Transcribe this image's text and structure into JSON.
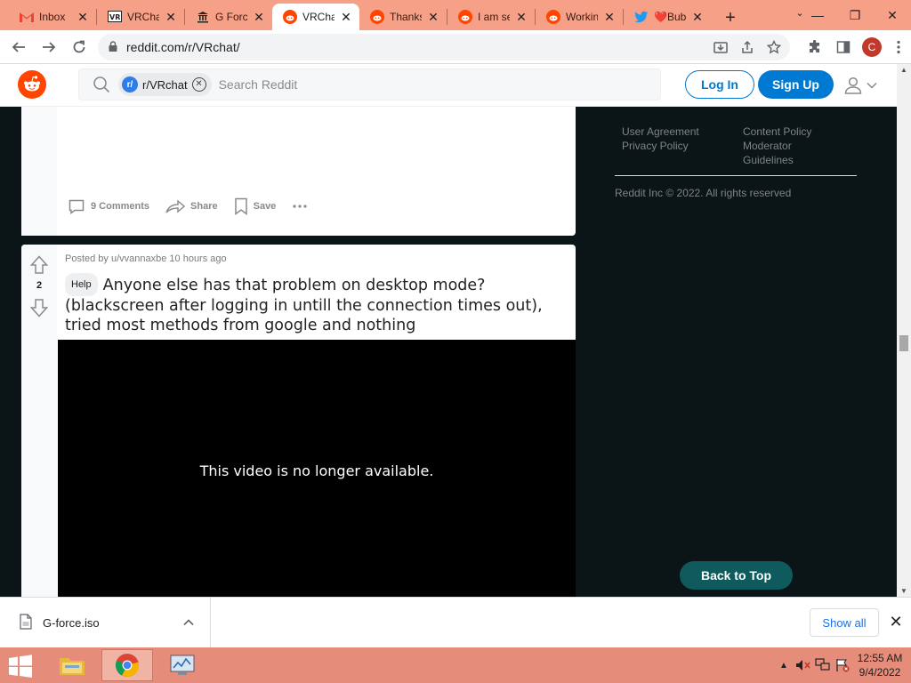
{
  "browser": {
    "tabs": [
      {
        "title": "Inbox",
        "icon": "gmail-icon",
        "active": false
      },
      {
        "title": "VRChat",
        "icon": "vrchat-icon",
        "active": false
      },
      {
        "title": "G Force",
        "icon": "bank-icon",
        "active": false
      },
      {
        "title": "VRChat",
        "icon": "reddit-icon",
        "active": true
      },
      {
        "title": "Thanks",
        "icon": "reddit-icon",
        "active": false
      },
      {
        "title": "I am se",
        "icon": "reddit-icon",
        "active": false
      },
      {
        "title": "Working",
        "icon": "reddit-icon",
        "active": false
      },
      {
        "title": "❤️Bub",
        "icon": "twitter-icon",
        "active": false
      }
    ],
    "url": "reddit.com/r/VRchat/",
    "profile_initial": "C"
  },
  "reddit_header": {
    "search_chip": "r/VRchat",
    "search_placeholder": "Search Reddit",
    "login_label": "Log In",
    "signup_label": "Sign Up"
  },
  "post1": {
    "comments_label": "9 Comments",
    "share_label": "Share",
    "save_label": "Save"
  },
  "post2": {
    "vote_count": "2",
    "meta": "Posted by u/vvannaxbe 10 hours ago",
    "flair": "Help",
    "title": "Anyone else has that problem on desktop mode? (blackscreen after logging in untill the connection times out), tried most methods from google and nothing",
    "video_message": "This video is no longer available."
  },
  "sidebar": {
    "links_left": [
      "User Agreement",
      "Privacy Policy"
    ],
    "links_right": [
      "Content Policy",
      "Moderator",
      "Guidelines"
    ],
    "copyright": "Reddit Inc © 2022. All rights reserved",
    "back_to_top": "Back to Top"
  },
  "downloads": {
    "file_name": "G-force.iso",
    "show_all": "Show all"
  },
  "taskbar": {
    "time": "12:55 AM",
    "date": "9/4/2022"
  },
  "colors": {
    "reddit_orange": "#ff4500",
    "reddit_blue": "#0079d3",
    "tabstrip": "#f6a087",
    "taskbar": "#e58d7a",
    "back_to_top": "#0e5a5c",
    "page_bg": "#0b1416"
  }
}
